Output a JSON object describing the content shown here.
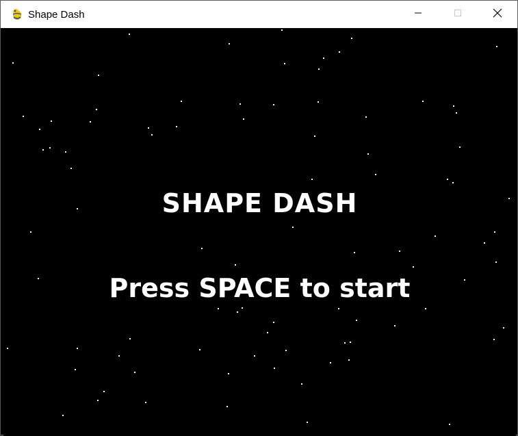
{
  "window": {
    "title": "Shape Dash",
    "icon": "pygame-snake-icon",
    "controls": {
      "minimize": "minimize-icon",
      "maximize": "maximize-icon",
      "close": "close-icon"
    }
  },
  "game": {
    "title": "SHAPE DASH",
    "prompt": "Press SPACE to start",
    "background_color": "#000000",
    "text_color": "#ffffff",
    "star_color": "#ffffff"
  }
}
